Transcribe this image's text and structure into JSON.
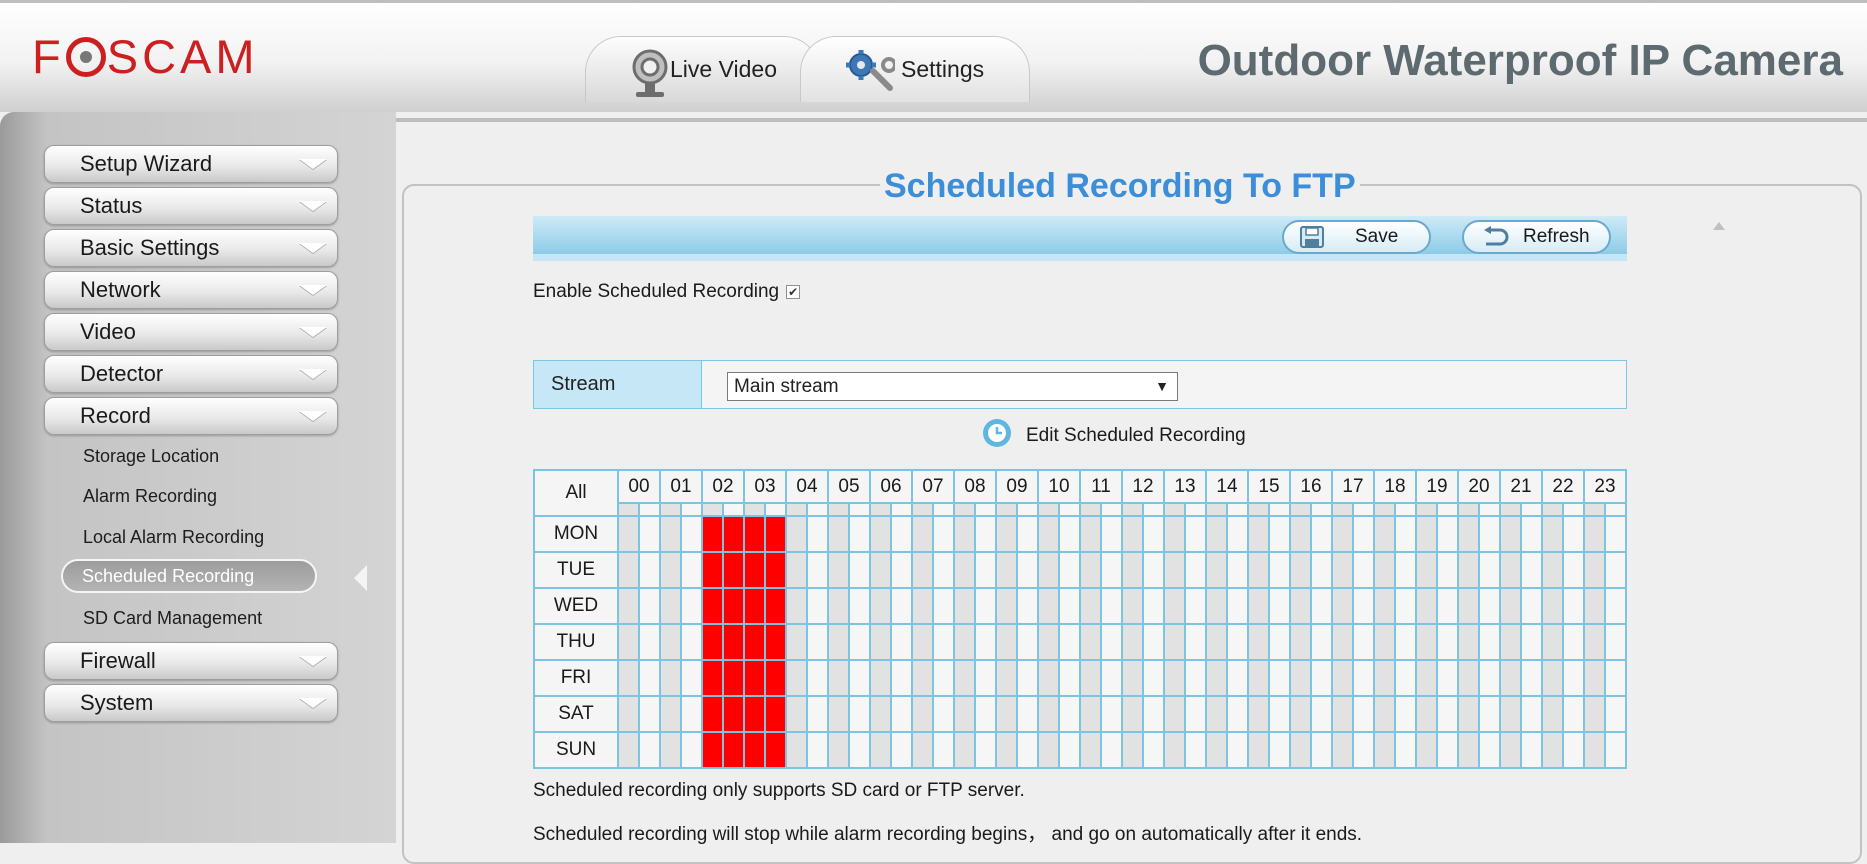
{
  "header": {
    "logo_text": "FOSCAM",
    "product_title": "Outdoor Waterproof IP Camera",
    "tabs": [
      {
        "label": "Live Video",
        "icon": "webcam-icon"
      },
      {
        "label": "Settings",
        "icon": "gears-icon"
      }
    ]
  },
  "sidebar": {
    "menus": [
      {
        "label": "Setup Wizard"
      },
      {
        "label": "Status"
      },
      {
        "label": "Basic Settings"
      },
      {
        "label": "Network"
      },
      {
        "label": "Video"
      },
      {
        "label": "Detector"
      },
      {
        "label": "Record"
      },
      {
        "label": "Firewall"
      },
      {
        "label": "System"
      }
    ],
    "record_sub_items": [
      {
        "label": "Storage Location"
      },
      {
        "label": "Alarm Recording"
      },
      {
        "label": "Local Alarm Recording"
      },
      {
        "label": "Scheduled Recording"
      },
      {
        "label": "SD Card Management"
      }
    ],
    "active_sub_item": "Scheduled Recording"
  },
  "main": {
    "title": "Scheduled Recording To FTP",
    "toolbar": {
      "save_label": "Save",
      "refresh_label": "Refresh"
    },
    "enable_label": "Enable Scheduled Recording",
    "enable_checked": true,
    "stream": {
      "label": "Stream",
      "selected": "Main stream"
    },
    "edit_schedule_label": "Edit Scheduled Recording",
    "schedule": {
      "all_label": "All",
      "hours": [
        "00",
        "01",
        "02",
        "03",
        "04",
        "05",
        "06",
        "07",
        "08",
        "09",
        "10",
        "11",
        "12",
        "13",
        "14",
        "15",
        "16",
        "17",
        "18",
        "19",
        "20",
        "21",
        "22",
        "23"
      ],
      "days": [
        "MON",
        "TUE",
        "WED",
        "THU",
        "FRI",
        "SAT",
        "SUN"
      ],
      "recorded_half_hour_slots": [
        4,
        5,
        6,
        7
      ],
      "colors": {
        "recorded": "#ff0000",
        "grid_border": "#7ec4e2",
        "odd_half": "#e2e2e2",
        "even_half": "#f6f6f6"
      }
    },
    "notes": [
      "Scheduled recording only supports SD card or FTP server.",
      "Scheduled recording will stop while alarm recording begins， and go on automatically after it ends."
    ]
  },
  "colors": {
    "title_blue": "#3c8ed8",
    "logo_red": "#cc2020",
    "toolbar_blue": "#a6d8ee"
  }
}
